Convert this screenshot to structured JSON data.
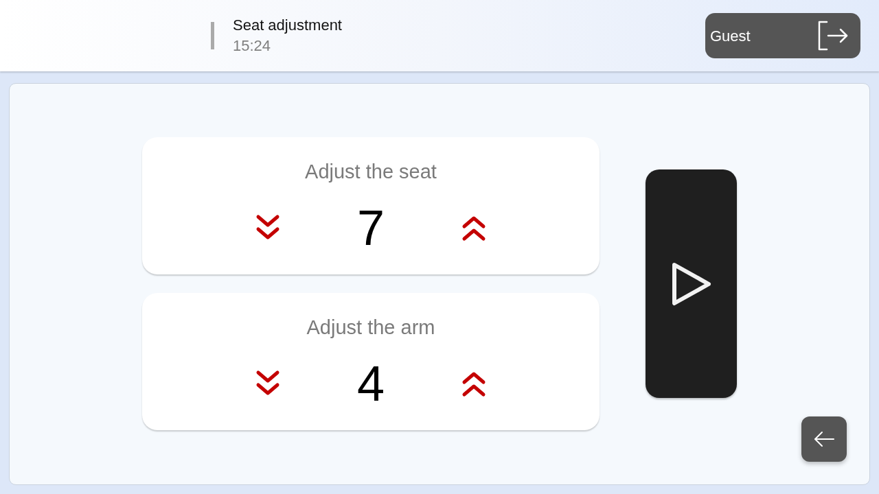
{
  "header": {
    "title": "Seat adjustment",
    "time": "15:24",
    "user_button": {
      "label": "Guest"
    }
  },
  "adjusters": [
    {
      "label": "Adjust the seat",
      "value": "7"
    },
    {
      "label": "Adjust the arm",
      "value": "4"
    }
  ]
}
